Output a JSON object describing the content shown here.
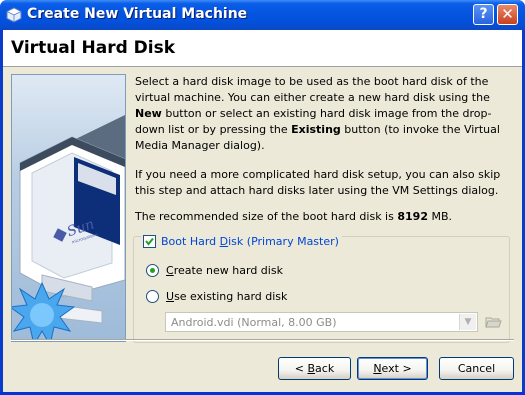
{
  "window": {
    "title": "Create New Virtual Machine",
    "help_label": "?",
    "close_label": "✕"
  },
  "page": {
    "title": "Virtual Hard Disk"
  },
  "side_image": {
    "logo_text": "Sun",
    "logo_subtext": "microsystems"
  },
  "description": {
    "p1_a": "Select a hard disk image to be used as the boot hard disk of the virtual machine. You can either create a new hard disk using the ",
    "p1_new": "New",
    "p1_b": " button or select an existing hard disk image from the drop-down list or by pressing the ",
    "p1_existing": "Existing",
    "p1_c": " button (to invoke the Virtual Media Manager dialog).",
    "p2": "If you need a more complicated hard disk setup, you can also skip this step and attach hard disks later using the VM Settings dialog.",
    "p3_a": "The recommended size of the boot hard disk is ",
    "p3_size": "8192",
    "p3_b": " MB."
  },
  "boot_disk": {
    "checked": true,
    "label_a": "Boot Hard ",
    "label_key": "D",
    "label_b": "isk (Primary Master)",
    "options": [
      {
        "key": "C",
        "rest": "reate new hard disk",
        "selected": true
      },
      {
        "key": "U",
        "rest": "se existing hard disk",
        "selected": false
      }
    ],
    "combo_value": "Android.vdi (Normal, 8.00 GB)"
  },
  "buttons": {
    "back_prefix": "< ",
    "back_key": "B",
    "back_rest": "ack",
    "next_key": "N",
    "next_rest": "ext >",
    "cancel": "Cancel"
  },
  "colors": {
    "title_bar": "#0454e0",
    "group_label": "#0046d5",
    "dialog_bg": "#ece9d8"
  }
}
